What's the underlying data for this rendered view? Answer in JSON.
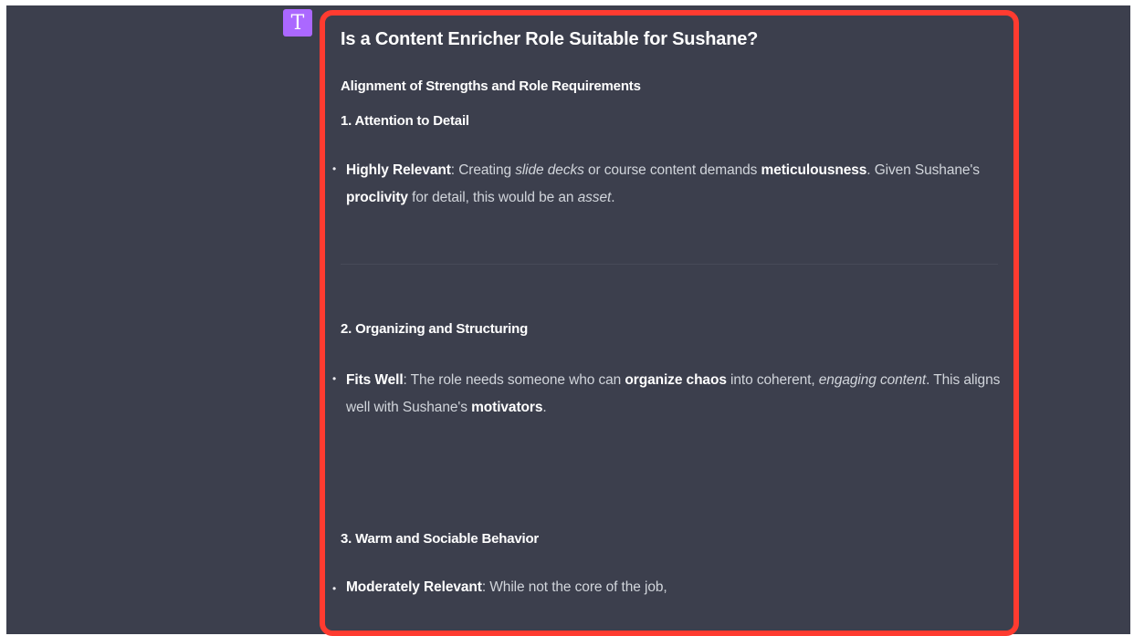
{
  "avatar": {
    "letter": "T"
  },
  "message": {
    "title": "Is a Content Enricher Role Suitable for Sushane?",
    "section_heading": "Alignment of Strengths and Role Requirements",
    "items": [
      {
        "heading": "1. Attention to Detail",
        "bullet": {
          "label": "Highly Relevant",
          "t1": ": Creating ",
          "i1": "slide decks",
          "t2": " or course content demands ",
          "b1": "meticulousness",
          "t3": ". Given Sushane's ",
          "b2": "proclivity",
          "t4": " for detail, this would be an ",
          "i2": "asset",
          "t5": "."
        }
      },
      {
        "heading": "2. Organizing and Structuring",
        "bullet": {
          "label": "Fits Well",
          "t1": ": The role needs someone who can ",
          "b1": "organize chaos",
          "t2": " into coherent, ",
          "i1": "engaging content",
          "t3": ". This aligns well with Sushane's ",
          "b2": "motivators",
          "t4": "."
        }
      },
      {
        "heading": "3. Warm and Sociable Behavior",
        "bullet": {
          "label": "Moderately Relevant",
          "t1": ": While not the core of the job,"
        }
      }
    ]
  },
  "colors": {
    "background": "#3c3f4d",
    "highlight_border": "#ff3b30",
    "avatar": "#ab68ff"
  }
}
